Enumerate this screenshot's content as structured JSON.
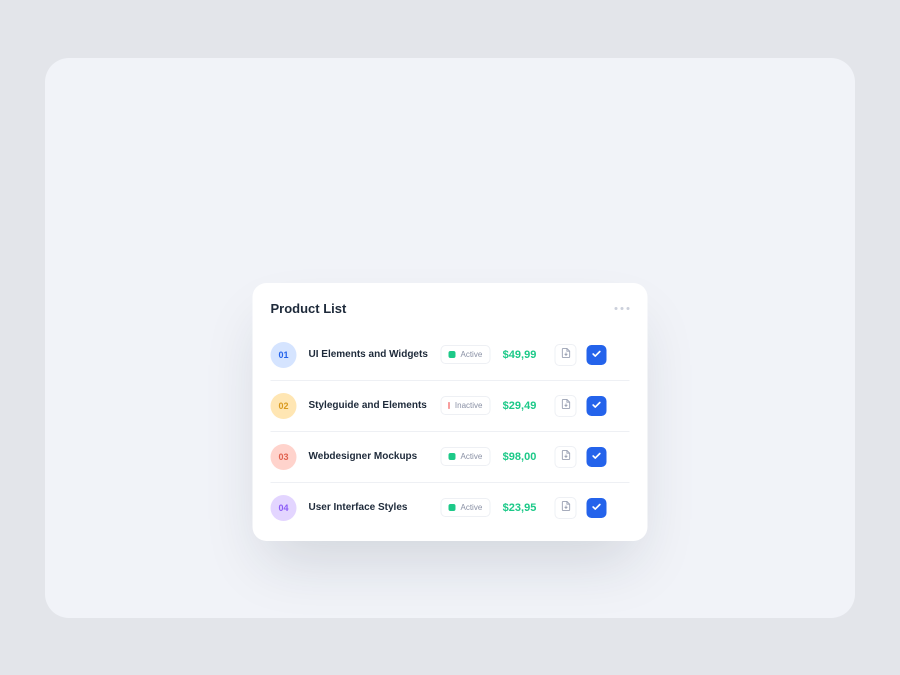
{
  "title": "Product List",
  "rows": [
    {
      "num": "01",
      "name": "UI Elements and Widgets",
      "status": "Active",
      "statusColor": "#1cc988",
      "price": "$49,99",
      "badgeBg": "#d5e4ff",
      "badgeFg": "#2463eb"
    },
    {
      "num": "02",
      "name": "Styleguide and Elements",
      "status": "Inactive",
      "statusColor": "#f03d3d",
      "price": "$29,49",
      "badgeBg": "#ffe6b3",
      "badgeFg": "#d99a1f"
    },
    {
      "num": "03",
      "name": "Webdesigner Mockups",
      "status": "Active",
      "statusColor": "#1cc988",
      "price": "$98,00",
      "badgeBg": "#ffd3cc",
      "badgeFg": "#e0624f"
    },
    {
      "num": "04",
      "name": "User Interface Styles",
      "status": "Active",
      "statusColor": "#1cc988",
      "price": "$23,95",
      "badgeBg": "#e3d5ff",
      "badgeFg": "#8b5cf6"
    }
  ]
}
